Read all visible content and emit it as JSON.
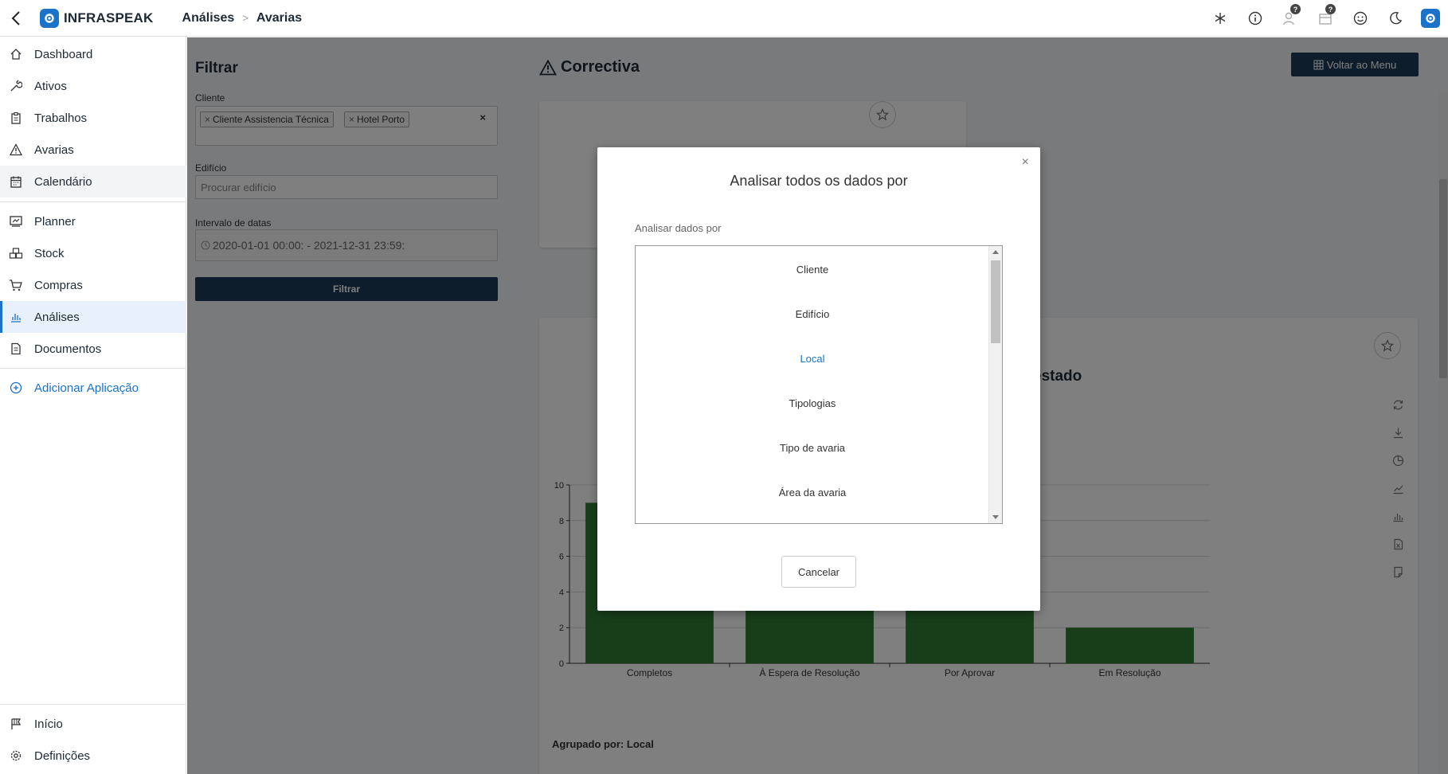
{
  "app": {
    "brand": "INFRASPEAK",
    "brand_color": "#1a73c8",
    "breadcrumbs": [
      "Análises",
      "Avarias"
    ],
    "top_icons": [
      "snowflake-icon",
      "info-icon",
      "user-help-icon",
      "calendar-help-icon",
      "smiley-icon",
      "moon-icon",
      "settings-logo-icon"
    ],
    "help_badge": "?"
  },
  "sidebar": {
    "items": [
      {
        "label": "Dashboard",
        "icon": "home-icon"
      },
      {
        "label": "Ativos",
        "icon": "wrench-icon"
      },
      {
        "label": "Trabalhos",
        "icon": "clipboard-icon"
      },
      {
        "label": "Avarias",
        "icon": "warning-icon"
      },
      {
        "label": "Calendário",
        "icon": "calendar-icon"
      },
      {
        "label": "Planner",
        "icon": "planner-icon"
      },
      {
        "label": "Stock",
        "icon": "boxes-icon"
      },
      {
        "label": "Compras",
        "icon": "cart-icon"
      },
      {
        "label": "Análises",
        "icon": "bar-chart-icon"
      },
      {
        "label": "Documentos",
        "icon": "document-icon"
      }
    ],
    "add_app": "Adicionar Aplicação",
    "bottom": [
      {
        "label": "Início",
        "icon": "flag-icon"
      },
      {
        "label": "Definições",
        "icon": "gear-icon"
      }
    ]
  },
  "filter": {
    "title": "Filtrar",
    "client_label": "Cliente",
    "client_tags": [
      "Cliente Assistencia Técnica",
      "Hotel Porto"
    ],
    "clear": "×",
    "building_label": "Edifício",
    "building_placeholder": "Procurar edifício",
    "date_label": "Intervalo de datas",
    "date_value": "2020-01-01 00:00: - 2021-12-31 23:59:",
    "button": "Filtrar"
  },
  "page": {
    "title": "Correctiva",
    "back_menu": "Voltar ao Menu",
    "chart_title_partial": "estado",
    "grouped_by": "Agrupado por: Local"
  },
  "chart_data": {
    "type": "bar",
    "categories": [
      "Completos",
      "À Espera de Resolução",
      "Por Aprovar",
      "Em Resolução"
    ],
    "values": [
      9,
      3,
      4,
      2
    ],
    "ylim": [
      0,
      10
    ],
    "yticks": [
      "0",
      "2",
      "4",
      "6",
      "8",
      "10"
    ],
    "color": "#2e7d32",
    "grid": true
  },
  "modal": {
    "title": "Analisar todos os dados por",
    "label": "Analisar dados por",
    "options": [
      "Cliente",
      "Edifício",
      "Local",
      "Tipologias",
      "Tipo de avaria",
      "Área da avaria"
    ],
    "selected": "Local",
    "close": "×",
    "cancel": "Cancelar"
  }
}
